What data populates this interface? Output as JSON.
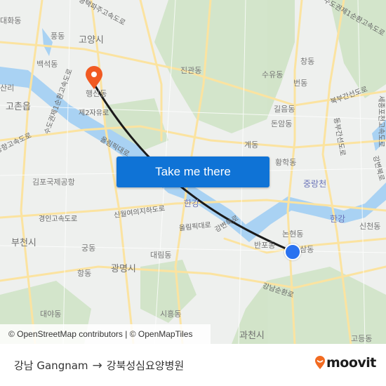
{
  "map": {
    "labels": {
      "goyang": "고양시",
      "pungdong": "풍동",
      "daehwa": "대화동",
      "baekseok": "백석동",
      "sanri": "산리",
      "gochon": "고촌읍",
      "haengsin": "행신동",
      "jeyu": "제2자유로",
      "jingwan": "진관동",
      "suyu": "수유동",
      "chang": "창동",
      "beon": "번동",
      "gireum": "길음동",
      "donam": "돈암동",
      "gye": "계동",
      "hwanghak": "황학동",
      "jungnang": "중랑천",
      "hangang_e": "한강",
      "hangang_c": "한강",
      "sincheon": "신천동",
      "nonhyeon": "논현동",
      "samdong": "삼동",
      "banpo": "반포동",
      "gimpo_airport": "김포국제공항",
      "gyeongin": "경인고속도로",
      "sinwol": "신월여의지하도로",
      "olympic": "올림픽대로",
      "olympic2": "올림픽대로",
      "gangbyeon": "강변북로",
      "bucheon": "부천시",
      "gung": "궁동",
      "hang": "항동",
      "gwangmyeong": "광명시",
      "daerim": "대림동",
      "daeya": "대야동",
      "siheung": "시흥동",
      "gangnam_sunhwan": "강남순환로",
      "gwacheon": "과천시",
      "godeung": "고등동",
      "airport_exp": "공항고속도로",
      "pyeongtaek": "평택파주고속도로",
      "sudo1": "수도권제1순환고속도로",
      "bukbu": "북부간선도로",
      "dongbu": "동부간선도로",
      "sejong": "세종포천고속도로",
      "gangbyeon_e": "강변북로",
      "sudo1_w": "수도권제1순환고속도로"
    },
    "origin_marker": "orange-destination-pin",
    "destination_marker": "blue-current-location-dot",
    "route_color": "#1a1a1a",
    "pin_color": "#f15a22",
    "dot_color": "#2a72f0"
  },
  "cta": {
    "label": "Take me there",
    "color": "#0f73d6"
  },
  "attribution": {
    "text": "© OpenStreetMap contributors | © OpenMapTiles"
  },
  "footer": {
    "from": "강남 Gangnam",
    "arrow": "→",
    "to": "강북성심요양병원",
    "brand": "moovit",
    "brand_color": "#f26b21"
  }
}
